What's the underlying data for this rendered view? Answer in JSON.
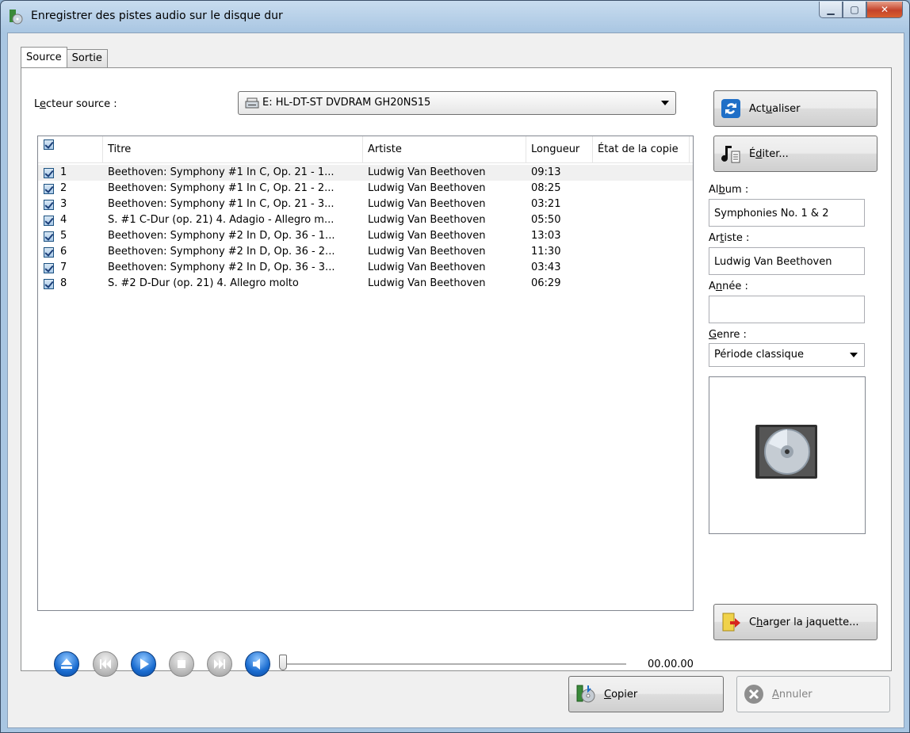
{
  "window": {
    "title": "Enregistrer des pistes audio sur le disque dur"
  },
  "tabs": [
    {
      "label": "Source",
      "active": true
    },
    {
      "label": "Sortie",
      "active": false
    }
  ],
  "source": {
    "label_pre": "L",
    "label_ul": "e",
    "label_post": "cteur source :",
    "drive": "E: HL-DT-ST DVDRAM GH20NS15"
  },
  "buttons": {
    "refresh": {
      "pre": "Act",
      "ul": "u",
      "post": "aliser"
    },
    "edit": {
      "pre": "É",
      "ul": "d",
      "post": "iter..."
    },
    "cover": {
      "pre": "C",
      "ul": "h",
      "post": "arger la jaquette..."
    },
    "copy": {
      "pre": "",
      "ul": "C",
      "post": "opier"
    },
    "cancel": {
      "pre": "",
      "ul": "A",
      "post": "nnuler"
    }
  },
  "columns": [
    "Titre",
    "Artiste",
    "Longueur",
    "État de la copie"
  ],
  "tracks": [
    {
      "num": "1",
      "title": "Beethoven: Symphony #1 In C, Op. 21 - 1...",
      "artist": "Ludwig Van Beethoven",
      "length": "09:13"
    },
    {
      "num": "2",
      "title": "Beethoven: Symphony #1 In C, Op. 21 - 2...",
      "artist": "Ludwig Van Beethoven",
      "length": "08:25"
    },
    {
      "num": "3",
      "title": "Beethoven: Symphony #1 In C, Op. 21 - 3...",
      "artist": "Ludwig Van Beethoven",
      "length": "03:21"
    },
    {
      "num": "4",
      "title": "S. #1 C-Dur (op. 21) 4. Adagio - Allegro m...",
      "artist": "Ludwig Van Beethoven",
      "length": "05:50"
    },
    {
      "num": "5",
      "title": "Beethoven: Symphony #2 In D, Op. 36 - 1...",
      "artist": "Ludwig Van Beethoven",
      "length": "13:03"
    },
    {
      "num": "6",
      "title": "Beethoven: Symphony #2 In D, Op. 36 - 2...",
      "artist": "Ludwig Van Beethoven",
      "length": "11:30"
    },
    {
      "num": "7",
      "title": "Beethoven: Symphony #2 In D, Op. 36 - 3...",
      "artist": "Ludwig Van Beethoven",
      "length": "03:43"
    },
    {
      "num": "8",
      "title": "S. #2 D-Dur (op. 21) 4. Allegro molto",
      "artist": "Ludwig Van Beethoven",
      "length": "06:29"
    }
  ],
  "meta": {
    "album_label": {
      "pre": "Al",
      "ul": "b",
      "post": "um :"
    },
    "album_value": "Symphonies No. 1 & 2",
    "artist_label": {
      "pre": "Ar",
      "ul": "t",
      "post": "iste :"
    },
    "artist_value": "Ludwig Van Beethoven",
    "year_label": {
      "pre": "A",
      "ul": "n",
      "post": "née :"
    },
    "year_value": "",
    "genre_label": {
      "pre": "",
      "ul": "G",
      "post": "enre :"
    },
    "genre_value": "Période classique"
  },
  "player": {
    "time": "00.00.00",
    "position_fraction": 0.0
  },
  "colors": {
    "accent_blue": "#1a6cd0",
    "close_red": "#c4432a"
  }
}
